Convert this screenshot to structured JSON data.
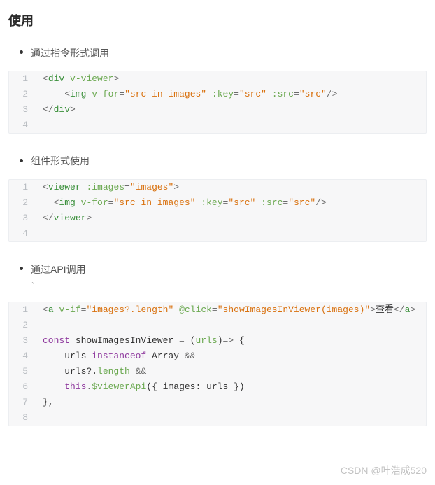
{
  "title": "使用",
  "sections": [
    {
      "label": "通过指令形式调用"
    },
    {
      "label": "组件形式使用"
    },
    {
      "label": "通过API调用"
    }
  ],
  "code1": {
    "l1": {
      "open": "<",
      "tag": "div",
      "sp": " ",
      "attr": "v-viewer",
      "close": ">"
    },
    "l2": {
      "pad": "    ",
      "open": "<",
      "tag": "img",
      "sp1": " ",
      "a1": "v-for",
      "eq1": "=",
      "v1": "\"src in images\"",
      "sp2": " ",
      "a2": ":key",
      "eq2": "=",
      "v2": "\"src\"",
      "sp3": " ",
      "a3": ":src",
      "eq3": "=",
      "v3": "\"src\"",
      "close": "/>"
    },
    "l3": {
      "open": "</",
      "tag": "div",
      "close": ">"
    }
  },
  "code2": {
    "l1": {
      "open": "<",
      "tag": "viewer",
      "sp": " ",
      "a1": ":images",
      "eq": "=",
      "v1": "\"images\"",
      "close": ">"
    },
    "l2": {
      "pad": "  ",
      "open": "<",
      "tag": "img",
      "sp1": " ",
      "a1": "v-for",
      "eq1": "=",
      "v1": "\"src in images\"",
      "sp2": " ",
      "a2": ":key",
      "eq2": "=",
      "v2": "\"src\"",
      "sp3": " ",
      "a3": ":src",
      "eq3": "=",
      "v3": "\"src\"",
      "close": "/>"
    },
    "l3": {
      "open": "</",
      "tag": "viewer",
      "close": ">"
    }
  },
  "code3": {
    "l1": {
      "open": "<",
      "tag": "a",
      "sp1": " ",
      "a1": "v-if",
      "eq1": "=",
      "v1": "\"images?.length\"",
      "sp2": " ",
      "a2": "@click",
      "eq2": "=",
      "v2": "\"showImagesInViewer(images)\"",
      "close": ">",
      "text": "查看",
      "copen": "</",
      "ctag": "a",
      "cclose": ">"
    },
    "l3a": "const",
    "l3b": " showImagesInViewer ",
    "l3c": "=",
    "l3d": " (",
    "l3e": "urls",
    "l3f": ")",
    "l3g": "=>",
    "l3h": " {",
    "l4a": "    urls ",
    "l4b": "instanceof",
    "l4c": " Array ",
    "l4d": "&&",
    "l5a": "    urls?.",
    "l5b": "length",
    "l5c": " ",
    "l5d": "&&",
    "l6a": "    ",
    "l6b": "this",
    "l6c": ".",
    "l6d": "$viewerApi",
    "l6e": "({ images: urls })",
    "l7": "},"
  },
  "line_numbers": {
    "n1": "1",
    "n2": "2",
    "n3": "3",
    "n4": "4",
    "n5": "5",
    "n6": "6",
    "n7": "7",
    "n8": "8"
  },
  "watermark": "CSDN @叶浩成520",
  "tick": "`"
}
